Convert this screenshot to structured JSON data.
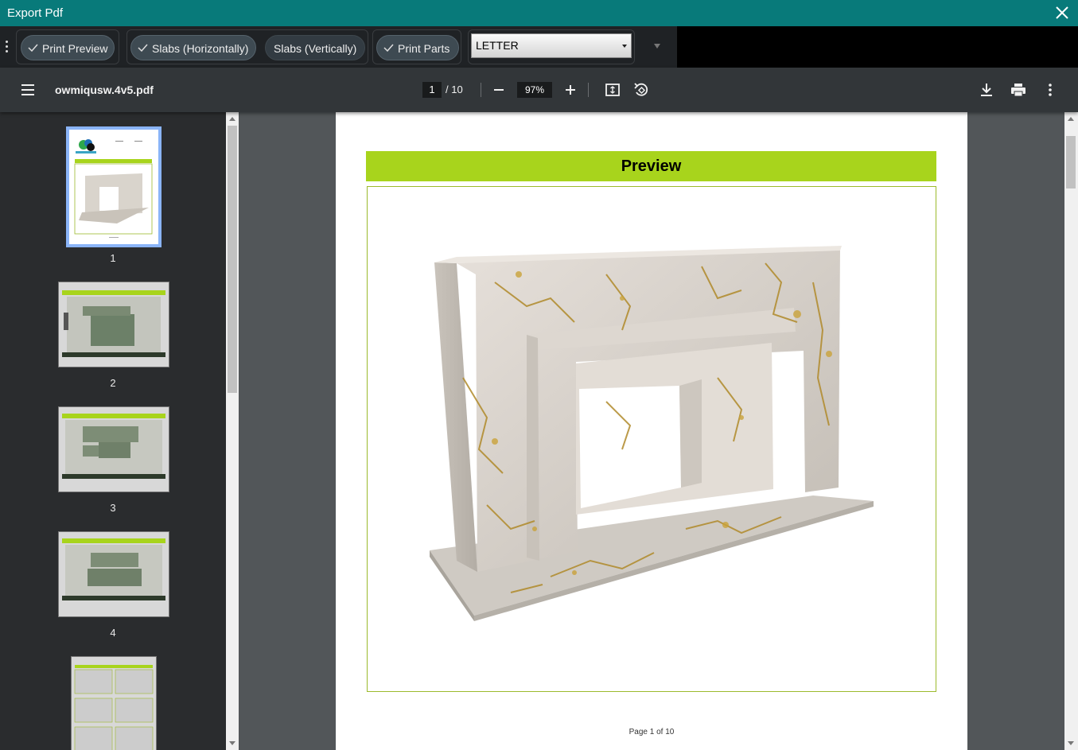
{
  "window": {
    "title": "Export Pdf"
  },
  "options": {
    "print_preview": "Print Preview",
    "slabs_horizontal": "Slabs (Horizontally)",
    "slabs_vertical": "Slabs (Vertically)",
    "print_parts": "Print Parts",
    "paper_size": "LETTER"
  },
  "viewer": {
    "filename": "owmiqusw.4v5.pdf",
    "current_page": "1",
    "total_pages": "/ 10",
    "zoom": "97%"
  },
  "thumbnails": [
    {
      "number": "1",
      "selected": true
    },
    {
      "number": "2",
      "selected": false
    },
    {
      "number": "3",
      "selected": false
    },
    {
      "number": "4",
      "selected": false
    }
  ],
  "document": {
    "heading": "Preview",
    "footer": "Page 1 of 10"
  },
  "colors": {
    "titlebar": "#087a7a",
    "heading_bg": "#a8d41c",
    "frame_border": "#9cba2c",
    "selected_thumb": "#8ab4f8"
  }
}
